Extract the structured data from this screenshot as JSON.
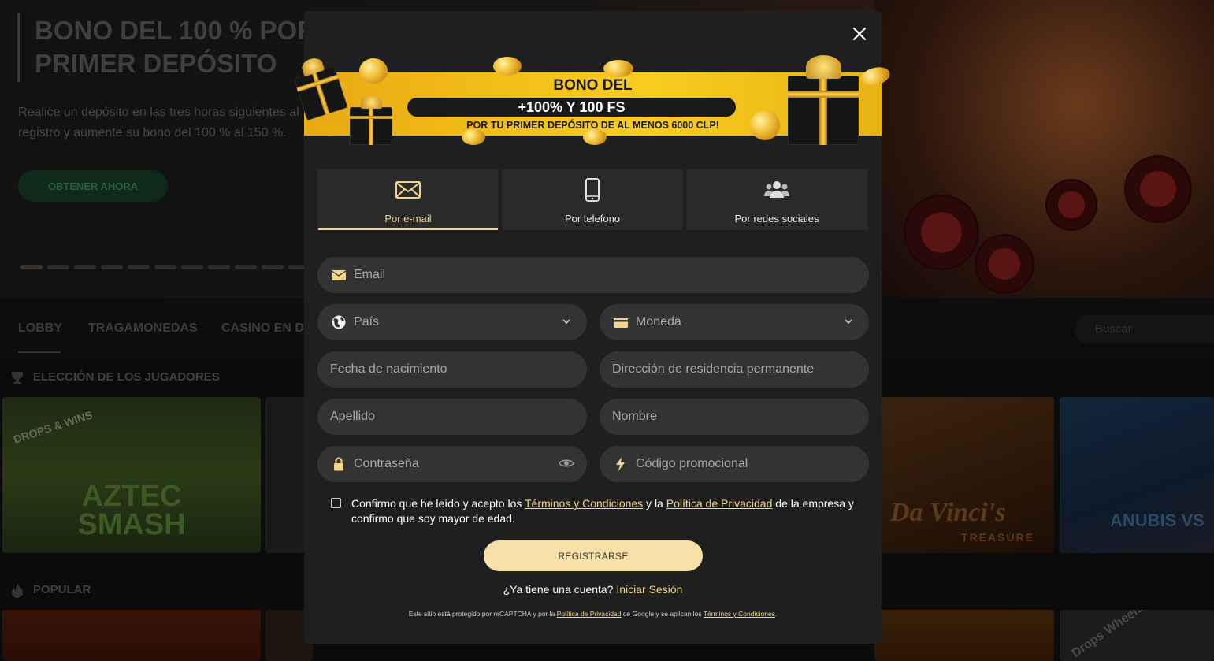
{
  "hero": {
    "title": "BONO DEL 100 % POR PRIMER DEPÓSITO",
    "text": "Realice un depósito en las tres horas siguientes al registro y aumente su bono del 100 % al 150 %.",
    "button": "OBTENER AHORA"
  },
  "nav": {
    "items": [
      "LOBBY",
      "TRAGAMONEDAS",
      "CASINO EN DI"
    ],
    "search_placeholder": "Buscar"
  },
  "sections": {
    "players_choice": "ELECCIÓN DE LOS JUGADORES",
    "popular": "POPULAR"
  },
  "games": {
    "aztec_line1": "AZTEC",
    "aztec_line2": "SMASH",
    "drops": "DROPS & WINS",
    "davinci": "Da Vinci's",
    "davinci_sub": "TREASURE",
    "anubis": "ANUBIS VS",
    "drops_wheels": "Drops Wheels"
  },
  "banner": {
    "top": "BONO DEL",
    "pill": "+100% Y 100 FS",
    "sub": "POR TU PRIMER DEPÓSITO DE AL MENOS 6000 CLP!"
  },
  "tabs": [
    {
      "label": "Por e-mail",
      "icon": "envelope-icon",
      "active": true
    },
    {
      "label": "Por telefono",
      "icon": "phone-icon",
      "active": false
    },
    {
      "label": "Por redes sociales",
      "icon": "users-icon",
      "active": false
    }
  ],
  "form": {
    "email_placeholder": "Email",
    "country_placeholder": "País",
    "currency_placeholder": "Moneda",
    "birthdate_placeholder": "Fecha de nacimiento",
    "address_placeholder": "Dirección de residencia permanente",
    "lastname_placeholder": "Apellido",
    "firstname_placeholder": "Nombre",
    "password_placeholder": "Contraseña",
    "promo_placeholder": "Código promocional"
  },
  "consent": {
    "t1": "Confirmo que he leído y acepto los ",
    "terms": "Términos y Condiciones",
    "t2": " y la ",
    "privacy": "Política de Privacidad",
    "t3": " de la empresa y confirmo que soy mayor de edad."
  },
  "register_button": "REGISTRARSE",
  "login": {
    "question": "¿Ya tiene una cuenta?",
    "link": "Iniciar Sesión"
  },
  "recaptcha": {
    "t1": "Este sitio está protegido por reCAPTCHA y por la ",
    "privacy": "Política de Privacidad",
    "t2": " de Google y se aplican los ",
    "terms": "Términos y Condiciones",
    "t3": "."
  },
  "colors": {
    "accent": "#f2d58a",
    "button": "#f7e1a9",
    "modal_bg": "#1f1f1f",
    "field_bg": "#333333",
    "banner_yellow": "#f4c21a"
  }
}
